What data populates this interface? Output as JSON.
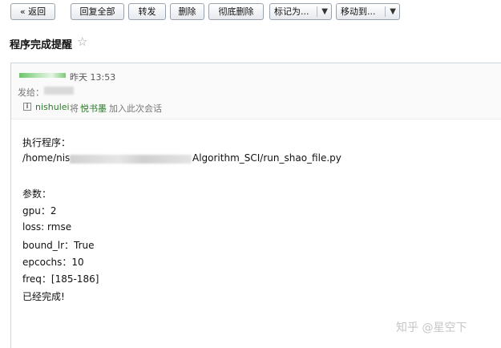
{
  "toolbar": {
    "back_label": "« 返回",
    "reply_all_label": "回复全部",
    "forward_label": "转发",
    "delete_label": "删除",
    "delete_forever_label": "彻底删除",
    "mark_as_label": "标记为...",
    "move_to_label": "移动到..."
  },
  "mail": {
    "subject": "程序完成提醒",
    "time": "昨天 13:53",
    "to_label": "发给：",
    "info_user": "nishulei",
    "info_mid": "将",
    "info_book": "悦书墨",
    "info_tail": "加入此次会话"
  },
  "body": {
    "line1": "执行程序：",
    "path_prefix": "/home/nis",
    "path_suffix": "Algorithm_SCI/run_shao_file.py",
    "params_title": "参数：",
    "params": [
      "gpu：2",
      "loss: rmse",
      "bound_lr：True",
      "epcochs：10",
      "freq：[185-186]"
    ],
    "done": "已经完成!"
  },
  "watermark": "知乎 @星空下"
}
